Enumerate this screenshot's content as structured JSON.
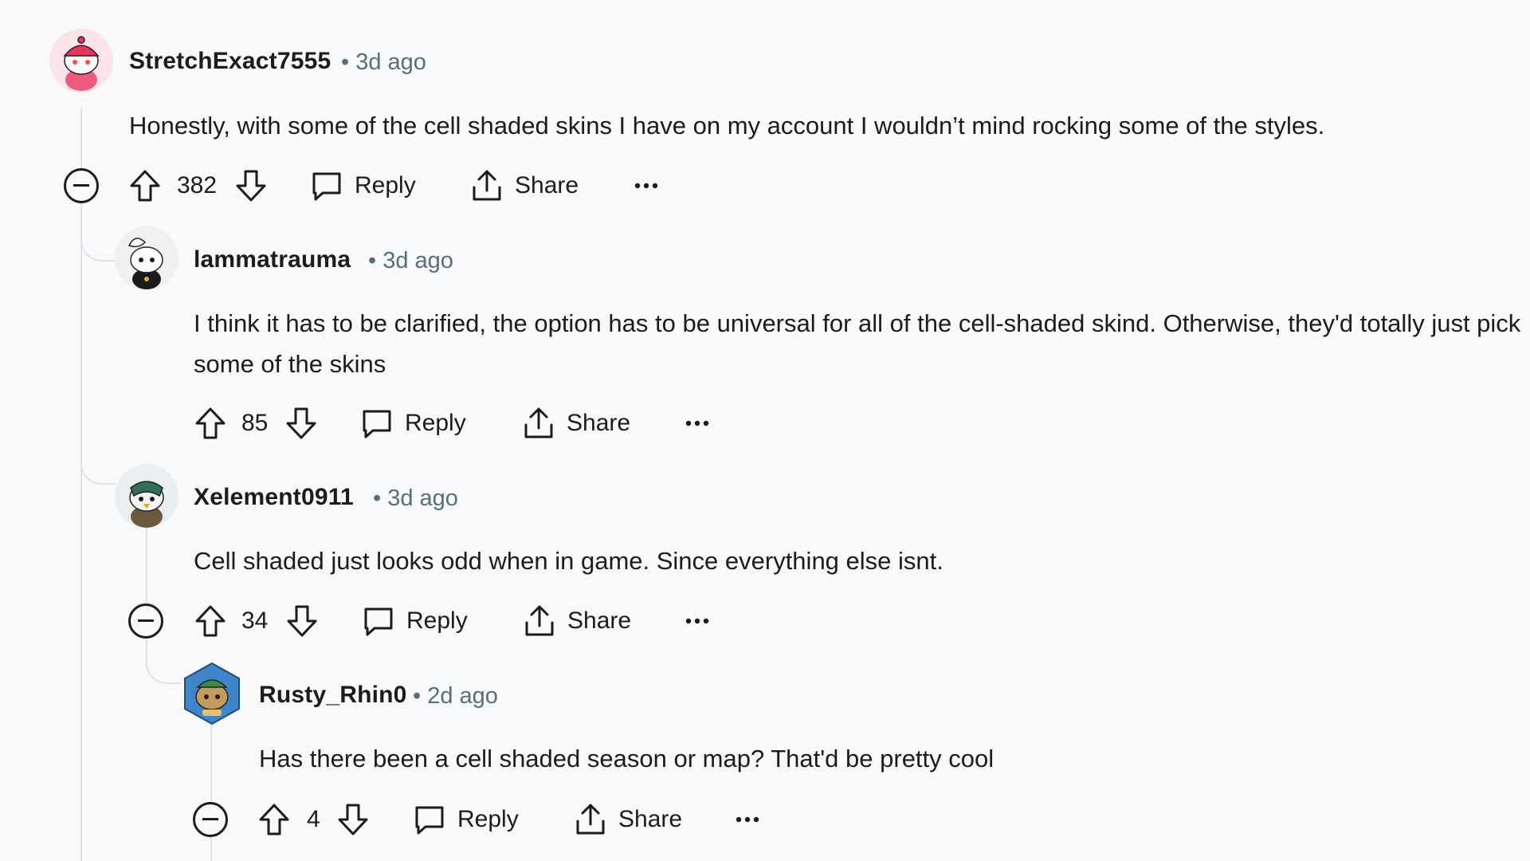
{
  "comments": [
    {
      "username": "StretchExact7555",
      "meta": "• 3d ago",
      "text": "Honestly, with some of the cell shaded skins I have on my account I wouldn’t mind rocking some of the styles.",
      "score": "382",
      "reply_label": "Reply",
      "share_label": "Share",
      "avatar_icon": "snoo-avatar-pink"
    },
    {
      "username": "lammatrauma",
      "meta": "• 3d ago",
      "text": "I think it has to be clarified, the option has to be universal for all of the cell-shaded skind. Otherwise, they'd totally just pick some of the skins",
      "score": "85",
      "reply_label": "Reply",
      "share_label": "Share",
      "avatar_icon": "snoo-avatar-hat"
    },
    {
      "username": "Xelement0911",
      "meta": "• 3d ago",
      "text": "Cell shaded just looks odd when in game. Since everything else isnt.",
      "score": "34",
      "reply_label": "Reply",
      "share_label": "Share",
      "avatar_icon": "snoo-avatar-hawk"
    },
    {
      "username": "Rusty_Rhin0",
      "meta": "• 2d ago",
      "text": "Has there been a cell shaded season or map? That'd be pretty cool",
      "score": "4",
      "reply_label": "Reply",
      "share_label": "Share",
      "avatar_icon": "snoo-avatar-hex"
    }
  ],
  "colors": {
    "background": "#f8f9fa",
    "text": "#1c1c1c",
    "meta": "#576f76",
    "thread_line": "#dfe3e6"
  }
}
